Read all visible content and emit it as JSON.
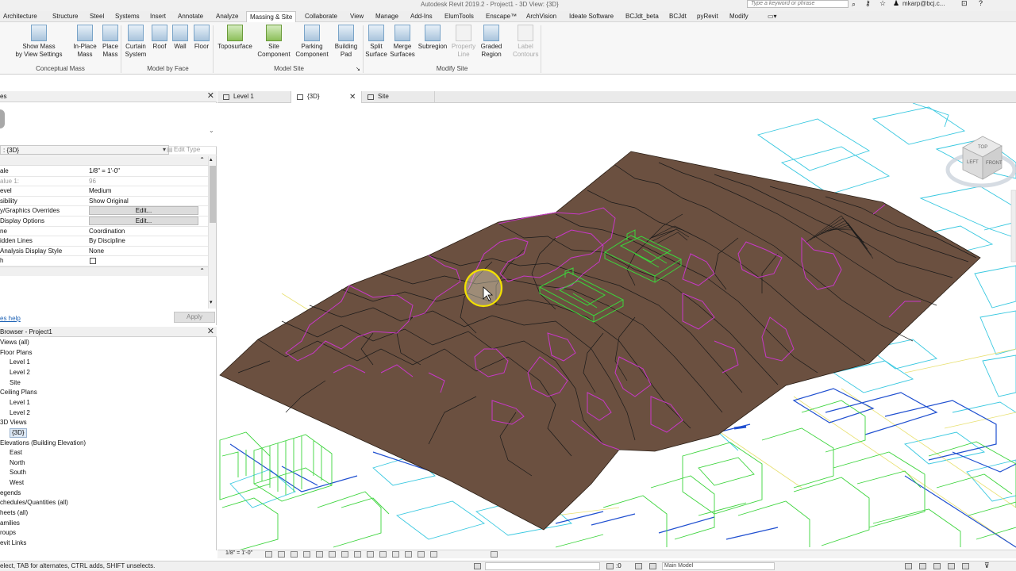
{
  "window": {
    "title": "Autodesk Revit 2019.2 - Project1 - 3D View: {3D}",
    "search_placeholder": "Type a keyword or phrase",
    "user": "mkarp@bcj.c..."
  },
  "ribbon_tabs": [
    {
      "label": "Architecture",
      "active": false
    },
    {
      "label": "Structure",
      "active": false
    },
    {
      "label": "Steel",
      "active": false
    },
    {
      "label": "Systems",
      "active": false
    },
    {
      "label": "Insert",
      "active": false
    },
    {
      "label": "Annotate",
      "active": false
    },
    {
      "label": "Analyze",
      "active": false
    },
    {
      "label": "Massing & Site",
      "active": true
    },
    {
      "label": "Collaborate",
      "active": false
    },
    {
      "label": "View",
      "active": false
    },
    {
      "label": "Manage",
      "active": false
    },
    {
      "label": "Add-Ins",
      "active": false
    },
    {
      "label": "ElumTools",
      "active": false
    },
    {
      "label": "Enscape™",
      "active": false
    },
    {
      "label": "ArchVision",
      "active": false
    },
    {
      "label": "Ideate Software",
      "active": false
    },
    {
      "label": "BCJdt_beta",
      "active": false
    },
    {
      "label": "BCJdt",
      "active": false
    },
    {
      "label": "pyRevit",
      "active": false
    },
    {
      "label": "Modify",
      "active": false
    }
  ],
  "ribbon": {
    "buttons": [
      {
        "l1": "Show Mass",
        "l2": "by View Settings",
        "icon": "show-mass-icon",
        "enabled": true
      },
      {
        "l1": "In-Place",
        "l2": "Mass",
        "icon": "in-place-mass-icon",
        "enabled": true
      },
      {
        "l1": "Place",
        "l2": "Mass",
        "icon": "place-mass-icon",
        "enabled": true
      },
      {
        "l1": "Curtain",
        "l2": "System",
        "icon": "curtain-system-icon",
        "enabled": true
      },
      {
        "l1": "Roof",
        "l2": "",
        "icon": "roof-icon",
        "enabled": true
      },
      {
        "l1": "Wall",
        "l2": "",
        "icon": "wall-icon",
        "enabled": true
      },
      {
        "l1": "Floor",
        "l2": "",
        "icon": "floor-icon",
        "enabled": true
      },
      {
        "l1": "Toposurface",
        "l2": "",
        "icon": "toposurface-icon",
        "enabled": true
      },
      {
        "l1": "Site",
        "l2": "Component",
        "icon": "site-component-icon",
        "enabled": true
      },
      {
        "l1": "Parking",
        "l2": "Component",
        "icon": "parking-component-icon",
        "enabled": true
      },
      {
        "l1": "Building",
        "l2": "Pad",
        "icon": "building-pad-icon",
        "enabled": true
      },
      {
        "l1": "Split",
        "l2": "Surface",
        "icon": "split-surface-icon",
        "enabled": true
      },
      {
        "l1": "Merge",
        "l2": "Surfaces",
        "icon": "merge-surfaces-icon",
        "enabled": true
      },
      {
        "l1": "Subregion",
        "l2": "",
        "icon": "subregion-icon",
        "enabled": true
      },
      {
        "l1": "Property",
        "l2": "Line",
        "icon": "property-line-icon",
        "enabled": false
      },
      {
        "l1": "Graded",
        "l2": "Region",
        "icon": "graded-region-icon",
        "enabled": true
      },
      {
        "l1": "Label",
        "l2": "Contours",
        "icon": "label-contours-icon",
        "enabled": false
      }
    ],
    "panels": [
      "Conceptual Mass",
      "Model by Face",
      "Model Site",
      "Modify Site"
    ]
  },
  "properties": {
    "title": "es",
    "type_selector": ": {3D}",
    "edit_type": "Edit Type",
    "rows": [
      {
        "name": "ale",
        "value": "1/8\" = 1'-0\"",
        "kind": "text"
      },
      {
        "name": "alue    1:",
        "value": "96",
        "kind": "gray"
      },
      {
        "name": "evel",
        "value": "Medium",
        "kind": "text"
      },
      {
        "name": "sibility",
        "value": "Show Original",
        "kind": "text"
      },
      {
        "name": "y/Graphics Overrides",
        "value": "Edit...",
        "kind": "button"
      },
      {
        "name": " Display Options",
        "value": "Edit...",
        "kind": "button"
      },
      {
        "name": "ne",
        "value": "Coordination",
        "kind": "text"
      },
      {
        "name": "idden Lines",
        "value": "By Discipline",
        "kind": "text"
      },
      {
        "name": " Analysis Display Style",
        "value": "None",
        "kind": "text"
      },
      {
        "name": "h",
        "value": "",
        "kind": "checkbox"
      }
    ],
    "help_link": "es help",
    "apply": "Apply"
  },
  "browser": {
    "title": "Browser - Project1",
    "items": [
      {
        "label": "Views (all)",
        "indent": 0,
        "selected": false
      },
      {
        "label": "Floor Plans",
        "indent": 0,
        "selected": false
      },
      {
        "label": "Level 1",
        "indent": 2,
        "selected": false
      },
      {
        "label": "Level 2",
        "indent": 2,
        "selected": false
      },
      {
        "label": "Site",
        "indent": 2,
        "selected": false
      },
      {
        "label": "Ceiling Plans",
        "indent": 0,
        "selected": false
      },
      {
        "label": "Level 1",
        "indent": 2,
        "selected": false
      },
      {
        "label": "Level 2",
        "indent": 2,
        "selected": false
      },
      {
        "label": "3D Views",
        "indent": 0,
        "selected": false
      },
      {
        "label": "{3D}",
        "indent": 2,
        "selected": true
      },
      {
        "label": "Elevations (Building Elevation)",
        "indent": 0,
        "selected": false
      },
      {
        "label": "East",
        "indent": 2,
        "selected": false
      },
      {
        "label": "North",
        "indent": 2,
        "selected": false
      },
      {
        "label": "South",
        "indent": 2,
        "selected": false
      },
      {
        "label": "West",
        "indent": 2,
        "selected": false
      },
      {
        "label": "egends",
        "indent": 0,
        "selected": false
      },
      {
        "label": "chedules/Quantities (all)",
        "indent": 0,
        "selected": false
      },
      {
        "label": "heets (all)",
        "indent": 0,
        "selected": false
      },
      {
        "label": "amilies",
        "indent": 0,
        "selected": false
      },
      {
        "label": "roups",
        "indent": 0,
        "selected": false
      },
      {
        "label": "evit Links",
        "indent": 0,
        "selected": false
      }
    ]
  },
  "view_tabs": [
    {
      "label": "Level 1",
      "icon": "floor-plan-icon",
      "active": false
    },
    {
      "label": "{3D}",
      "icon": "3d-view-icon",
      "active": true
    },
    {
      "label": "Site",
      "icon": "floor-plan-icon",
      "active": false
    }
  ],
  "viewcube": {
    "top": "TOP",
    "left": "LEFT",
    "front": "FRONT"
  },
  "view_control": {
    "scale": "1/8\" = 1'-0\""
  },
  "status": {
    "text": "elect, TAB for alternates, CTRL adds, SHIFT unselects.",
    "zero": ":0",
    "model": "Main Model"
  },
  "colors": {
    "terrain": "#6b5040",
    "contour": "#1a1a1a",
    "property_magenta": "#c838c8",
    "mass_green": "#3cd43c",
    "link_cyan": "#38c8e0",
    "link_blue": "#1f4fd0",
    "cursor_ring": "#f2e000"
  }
}
